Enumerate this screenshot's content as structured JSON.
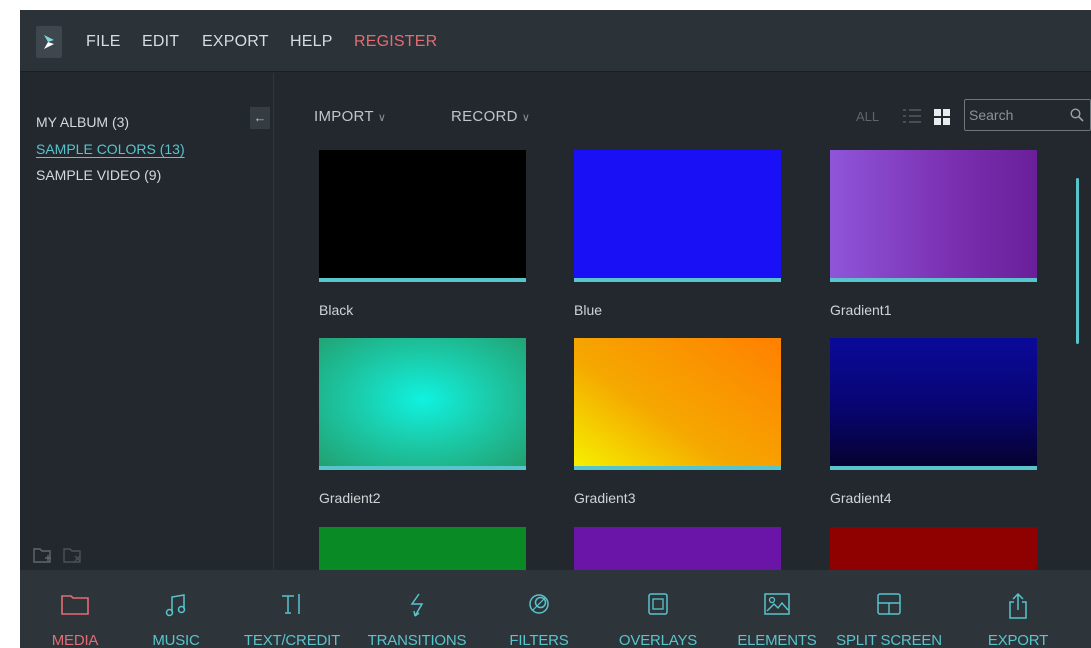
{
  "menu": {
    "items": [
      "FILE",
      "EDIT",
      "EXPORT",
      "HELP"
    ],
    "register": "REGISTER"
  },
  "sidebar": {
    "albums": [
      {
        "label": "MY ALBUM (3)",
        "active": false
      },
      {
        "label": "SAMPLE COLORS (13)",
        "active": true
      },
      {
        "label": "SAMPLE VIDEO (9)",
        "active": false
      }
    ],
    "collapse_icon": "arrow-left-icon",
    "footer_icons": [
      "add-folder-icon",
      "delete-folder-icon"
    ]
  },
  "toolbar": {
    "import_label": "IMPORT",
    "record_label": "RECORD",
    "filter_label": "ALL",
    "search_placeholder": "Search"
  },
  "media": [
    {
      "label": "Black",
      "color": "#000000"
    },
    {
      "label": "Blue",
      "color": "#1a10f5"
    },
    {
      "label": "Gradient1",
      "color": "#8f55d9"
    },
    {
      "label": "Gradient2",
      "color": "#10e8d8"
    },
    {
      "label": "Gradient3",
      "color": "#f5b000"
    },
    {
      "label": "Gradient4",
      "color": "#0d0a6e"
    },
    {
      "label": "",
      "color": "#0a8a24"
    },
    {
      "label": "",
      "color": "#6a14a8"
    },
    {
      "label": "",
      "color": "#8f0000"
    }
  ],
  "tabs": [
    {
      "label": "MEDIA",
      "icon": "folder-icon",
      "active": true
    },
    {
      "label": "MUSIC",
      "icon": "music-note-icon",
      "active": false
    },
    {
      "label": "TEXT/CREDIT",
      "icon": "text-cursor-icon",
      "active": false
    },
    {
      "label": "TRANSITIONS",
      "icon": "transition-arrows-icon",
      "active": false
    },
    {
      "label": "FILTERS",
      "icon": "filter-circles-icon",
      "active": false
    },
    {
      "label": "OVERLAYS",
      "icon": "overlay-square-icon",
      "active": false
    },
    {
      "label": "ELEMENTS",
      "icon": "image-icon",
      "active": false
    },
    {
      "label": "SPLIT SCREEN",
      "icon": "split-screen-icon",
      "active": false
    },
    {
      "label": "EXPORT",
      "icon": "share-upload-icon",
      "active": false
    }
  ],
  "colors": {
    "accent": "#58c4cc",
    "active_red": "#e56b73"
  }
}
